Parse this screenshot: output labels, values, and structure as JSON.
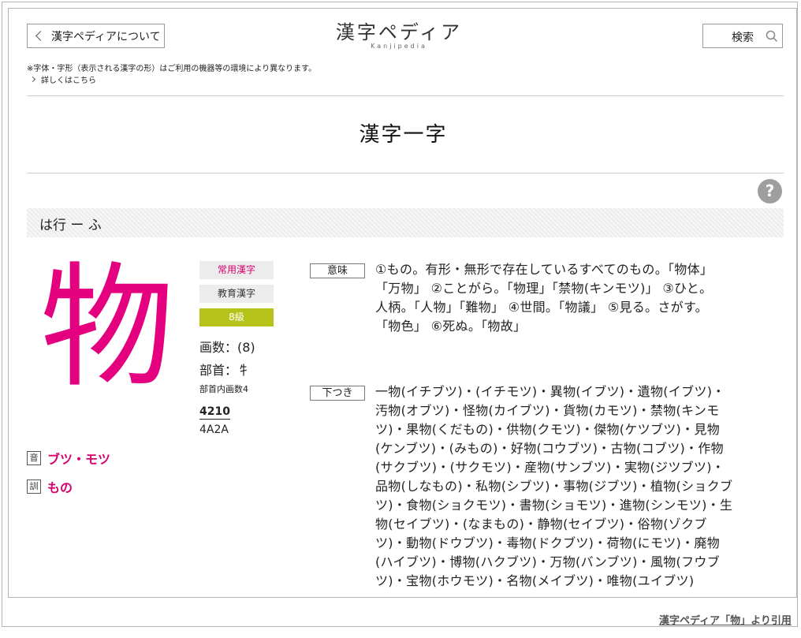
{
  "header": {
    "about_label": "漢字ペディアについて",
    "logo_jp": "漢字ペディア",
    "logo_en": "Kanjipedia",
    "search_label": "検索",
    "note": "※字体・字形（表示される漢字の形）はご利用の機器等の環境により異なります。",
    "more_link": "詳しくはこちら"
  },
  "page_title": "漢字一字",
  "help_label": "?",
  "index_band": "は行 ー ふ",
  "kanji": {
    "character": "物",
    "badges": {
      "joyo": "常用漢字",
      "kyoiku": "教育漢字",
      "level": "8級"
    },
    "strokes": "画数：(8)",
    "radical": "部首：牜",
    "radical_strokes": "部首内画数4",
    "jis_code": "4210",
    "unicode": "4A2A",
    "on_tag": "音",
    "on_reading": "ブツ・モツ",
    "kun_tag": "訓",
    "kun_reading": "もの"
  },
  "meaning": {
    "label": "意味",
    "lines": [
      "①もの。有形・無形で存在しているすべてのもの。「物体」",
      "「万物」 ②ことがら。「物理」「禁物(キンモツ)」 ③ひと。",
      "人柄。「人物」「難物」 ④世間。「物議」 ⑤見る。さがす。",
      "「物色」 ⑥死ぬ。「物故」"
    ]
  },
  "shitatsuki": {
    "label": "下つき",
    "lines": [
      "一物(イチブツ)・(イチモツ)・異物(イブツ)・遺物(イブツ)・",
      "汚物(オブツ)・怪物(カイブツ)・貨物(カモツ)・禁物(キンモ",
      "ツ)・果物(くだもの)・供物(クモツ)・傑物(ケツブツ)・見物",
      "(ケンブツ)・(みもの)・好物(コウブツ)・古物(コブツ)・作物",
      "(サクブツ)・(サクモツ)・産物(サンブツ)・実物(ジツブツ)・",
      "品物(しなもの)・私物(シブツ)・事物(ジブツ)・植物(ショクブ",
      "ツ)・食物(ショクモツ)・書物(ショモツ)・進物(シンモツ)・生",
      "物(セイブツ)・(なまもの)・静物(セイブツ)・俗物(ゾクブ",
      "ツ)・動物(ドウブツ)・毒物(ドクブツ)・荷物(にモツ)・廃物",
      "(ハイブツ)・博物(ハクブツ)・万物(バンブツ)・風物(フウブ",
      "ツ)・宝物(ホウモツ)・名物(メイブツ)・唯物(ユイブツ)"
    ]
  },
  "citation": "漢字ペディア「物」より引用"
}
